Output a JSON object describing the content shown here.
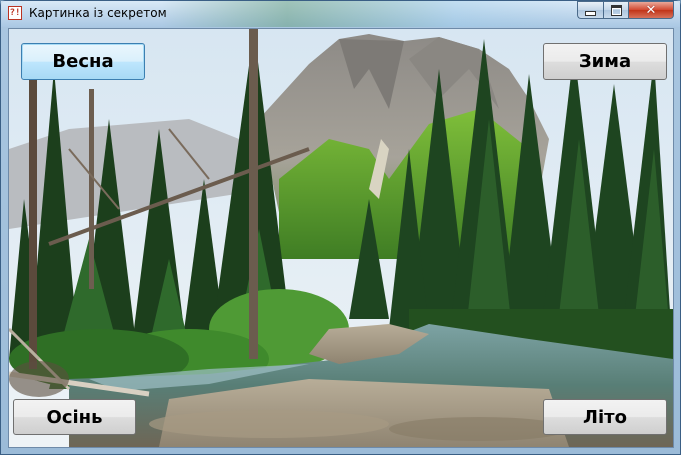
{
  "window": {
    "title": "Картинка із секретом",
    "icon_glyph": "?!",
    "icon": "app-question-icon"
  },
  "caption_buttons": {
    "minimize_icon": "minimize-icon",
    "maximize_icon": "maximize-icon",
    "close_icon": "close-icon",
    "close_glyph": "✕"
  },
  "buttons": {
    "spring": "Весна",
    "winter": "Зима",
    "autumn": "Осінь",
    "summer": "Літо"
  },
  "colors": {
    "close_red": "#c13418",
    "focus_blue": "#3c7fb1",
    "sky": "#cfe0ee",
    "forest": "#1f4a22",
    "water": "#5f8a86"
  }
}
